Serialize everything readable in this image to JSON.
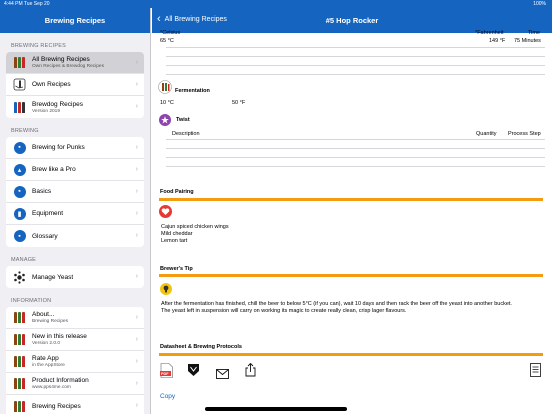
{
  "status": {
    "time": "4:44 PM   Tue Sep 20",
    "battery": "100%"
  },
  "sidebar": {
    "title": "Brewing Recipes",
    "sections": [
      {
        "header": "BREWING RECIPES",
        "items": [
          {
            "title": "All Brewing Recipes",
            "sub": "Own Recipes & Brewdog Recipes",
            "icon": "beer-bottles-icon",
            "selected": true
          },
          {
            "title": "Own Recipes",
            "sub": "",
            "icon": "hand-bottle-icon"
          },
          {
            "title": "Brewdog Recipes",
            "sub": "Version 2019",
            "icon": "brewdog-bottles-icon"
          }
        ]
      },
      {
        "header": "BREWING",
        "items": [
          {
            "title": "Brewing for Punks",
            "sub": "",
            "icon": "book-icon"
          },
          {
            "title": "Brew like a Pro",
            "sub": "",
            "icon": "flask-icon"
          },
          {
            "title": "Basics",
            "sub": "",
            "icon": "book-icon"
          },
          {
            "title": "Equipment",
            "sub": "",
            "icon": "kettle-icon"
          },
          {
            "title": "Glossary",
            "sub": "",
            "icon": "book-icon"
          }
        ]
      },
      {
        "header": "MANAGE",
        "items": [
          {
            "title": "Manage Yeast",
            "sub": "",
            "icon": "yeast-icon"
          }
        ]
      },
      {
        "header": "INFORMATION",
        "items": [
          {
            "title": "About...",
            "sub": "Brewing Recipes",
            "icon": "beer-bottles-icon"
          },
          {
            "title": "New in this release",
            "sub": "Version 2.0.0",
            "icon": "beer-bottles-icon"
          },
          {
            "title": "Rate App",
            "sub": "in the AppStore",
            "icon": "beer-bottles-icon"
          },
          {
            "title": "Product Information",
            "sub": "www.pps4me.com",
            "icon": "beer-bottles-icon"
          },
          {
            "title": "Brewing Recipes",
            "sub": "",
            "icon": "beer-bottles-icon"
          }
        ]
      }
    ]
  },
  "main": {
    "back_label": "All Brewing Recipes",
    "title": "#5 Hop Rocker",
    "mash": {
      "col_celsius": "°Celsius",
      "col_fahrenheit": "°Fahrenheit",
      "col_time": "Time",
      "celsius": "65 °C",
      "fahrenheit": "149 °F",
      "time": "75 Minutes"
    },
    "fermentation": {
      "label": "Fermentation",
      "celsius": "10 °C",
      "fahrenheit": "50 °F"
    },
    "twist": {
      "label": "Twist",
      "col_description": "Description",
      "col_quantity": "Quantity",
      "col_step": "Process Step"
    },
    "food_pairing": {
      "label": "Food Pairing",
      "items": [
        "Cajun spiced chicken wings",
        "Mild cheddar",
        "Lemon tart"
      ]
    },
    "brewers_tip": {
      "label": "Brewer's Tip",
      "line1": "After the fermentation has finished, chill the beer to below 5°C (if you can), wait 10 days and then rack the beer off the yeast into another bucket.",
      "line2": "The yeast left in suspension will carry on working its magic to create really clean, crisp lager flavours."
    },
    "datasheet": {
      "label": "Datasheet & Brewing Protocols",
      "pdf_badge": "PDF"
    },
    "copy_label": "Copy"
  },
  "colors": {
    "nav_blue": "#1565c0",
    "accent_orange": "#f39c12",
    "selected_row": "#d1d1d6"
  }
}
